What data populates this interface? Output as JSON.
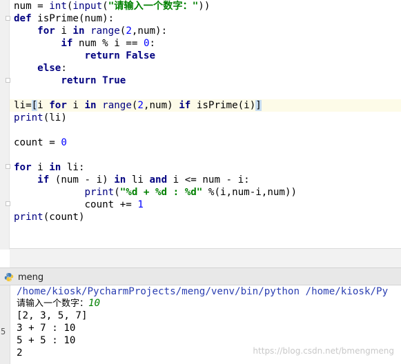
{
  "editor": {
    "lines": [
      [
        [
          "num = ",
          ""
        ],
        [
          "int",
          "bi"
        ],
        [
          "(",
          ""
        ],
        [
          "input",
          "bi"
        ],
        [
          "(",
          ""
        ],
        [
          "\"请输入一个数字：\"",
          "st"
        ],
        [
          "))",
          ""
        ]
      ],
      [
        [
          "def",
          "kw"
        ],
        [
          " isPrime(num):",
          ""
        ]
      ],
      [
        [
          "    ",
          ""
        ],
        [
          "for",
          "kw"
        ],
        [
          " i ",
          ""
        ],
        [
          "in",
          "kw"
        ],
        [
          " ",
          ""
        ],
        [
          "range",
          "bi"
        ],
        [
          "(",
          ""
        ],
        [
          "2",
          "nm"
        ],
        [
          ",num):",
          ""
        ]
      ],
      [
        [
          "        ",
          ""
        ],
        [
          "if",
          "kw"
        ],
        [
          " num % i == ",
          ""
        ],
        [
          "0",
          "nm"
        ],
        [
          ":",
          ""
        ]
      ],
      [
        [
          "            ",
          ""
        ],
        [
          "return",
          "kw"
        ],
        [
          " ",
          ""
        ],
        [
          "False",
          "kw"
        ]
      ],
      [
        [
          "    ",
          ""
        ],
        [
          "else",
          "kw"
        ],
        [
          ":",
          ""
        ]
      ],
      [
        [
          "        ",
          ""
        ],
        [
          "return",
          "kw"
        ],
        [
          " ",
          ""
        ],
        [
          "True",
          "kw"
        ]
      ],
      [],
      [
        [
          "li=",
          ""
        ],
        [
          "[",
          "hl"
        ],
        [
          "i ",
          ""
        ],
        [
          "for",
          "kw"
        ],
        [
          " i ",
          ""
        ],
        [
          "in",
          "kw"
        ],
        [
          " ",
          ""
        ],
        [
          "range",
          "bi"
        ],
        [
          "(",
          ""
        ],
        [
          "2",
          "nm"
        ],
        [
          ",num) ",
          ""
        ],
        [
          "if",
          "kw"
        ],
        [
          " isPrime(i)",
          ""
        ],
        [
          "]",
          "hl"
        ]
      ],
      [
        [
          "print",
          "bi"
        ],
        [
          "(li)",
          ""
        ]
      ],
      [],
      [
        [
          "count = ",
          ""
        ],
        [
          "0",
          "nm"
        ]
      ],
      [],
      [
        [
          "for",
          "kw"
        ],
        [
          " i ",
          ""
        ],
        [
          "in",
          "kw"
        ],
        [
          " li:",
          ""
        ]
      ],
      [
        [
          "    ",
          ""
        ],
        [
          "if",
          "kw"
        ],
        [
          " (num - i) ",
          ""
        ],
        [
          "in",
          "kw"
        ],
        [
          " li ",
          ""
        ],
        [
          "and",
          "kw"
        ],
        [
          " i <= num - i:",
          ""
        ]
      ],
      [
        [
          "            ",
          ""
        ],
        [
          "print",
          "bi"
        ],
        [
          "(",
          ""
        ],
        [
          "\"%d + %d : %d\"",
          "st"
        ],
        [
          " %(i,num-i,num))",
          ""
        ]
      ],
      [
        [
          "            count += ",
          ""
        ],
        [
          "1",
          "nm"
        ]
      ],
      [
        [
          "print",
          "bi"
        ],
        [
          "(count)",
          ""
        ]
      ]
    ]
  },
  "run_panel": {
    "tab_label": "meng",
    "gutter_digit": "5"
  },
  "console": {
    "command": "/home/kiosk/PycharmProjects/meng/venv/bin/python /home/kiosk/Py",
    "prompt": "请输入一个数字：",
    "user_input": "10",
    "output": [
      "[2, 3, 5, 7]",
      "3 + 7 : 10",
      "5 + 5 : 10",
      "2"
    ]
  },
  "watermark": "https://blog.csdn.net/bmengmeng"
}
